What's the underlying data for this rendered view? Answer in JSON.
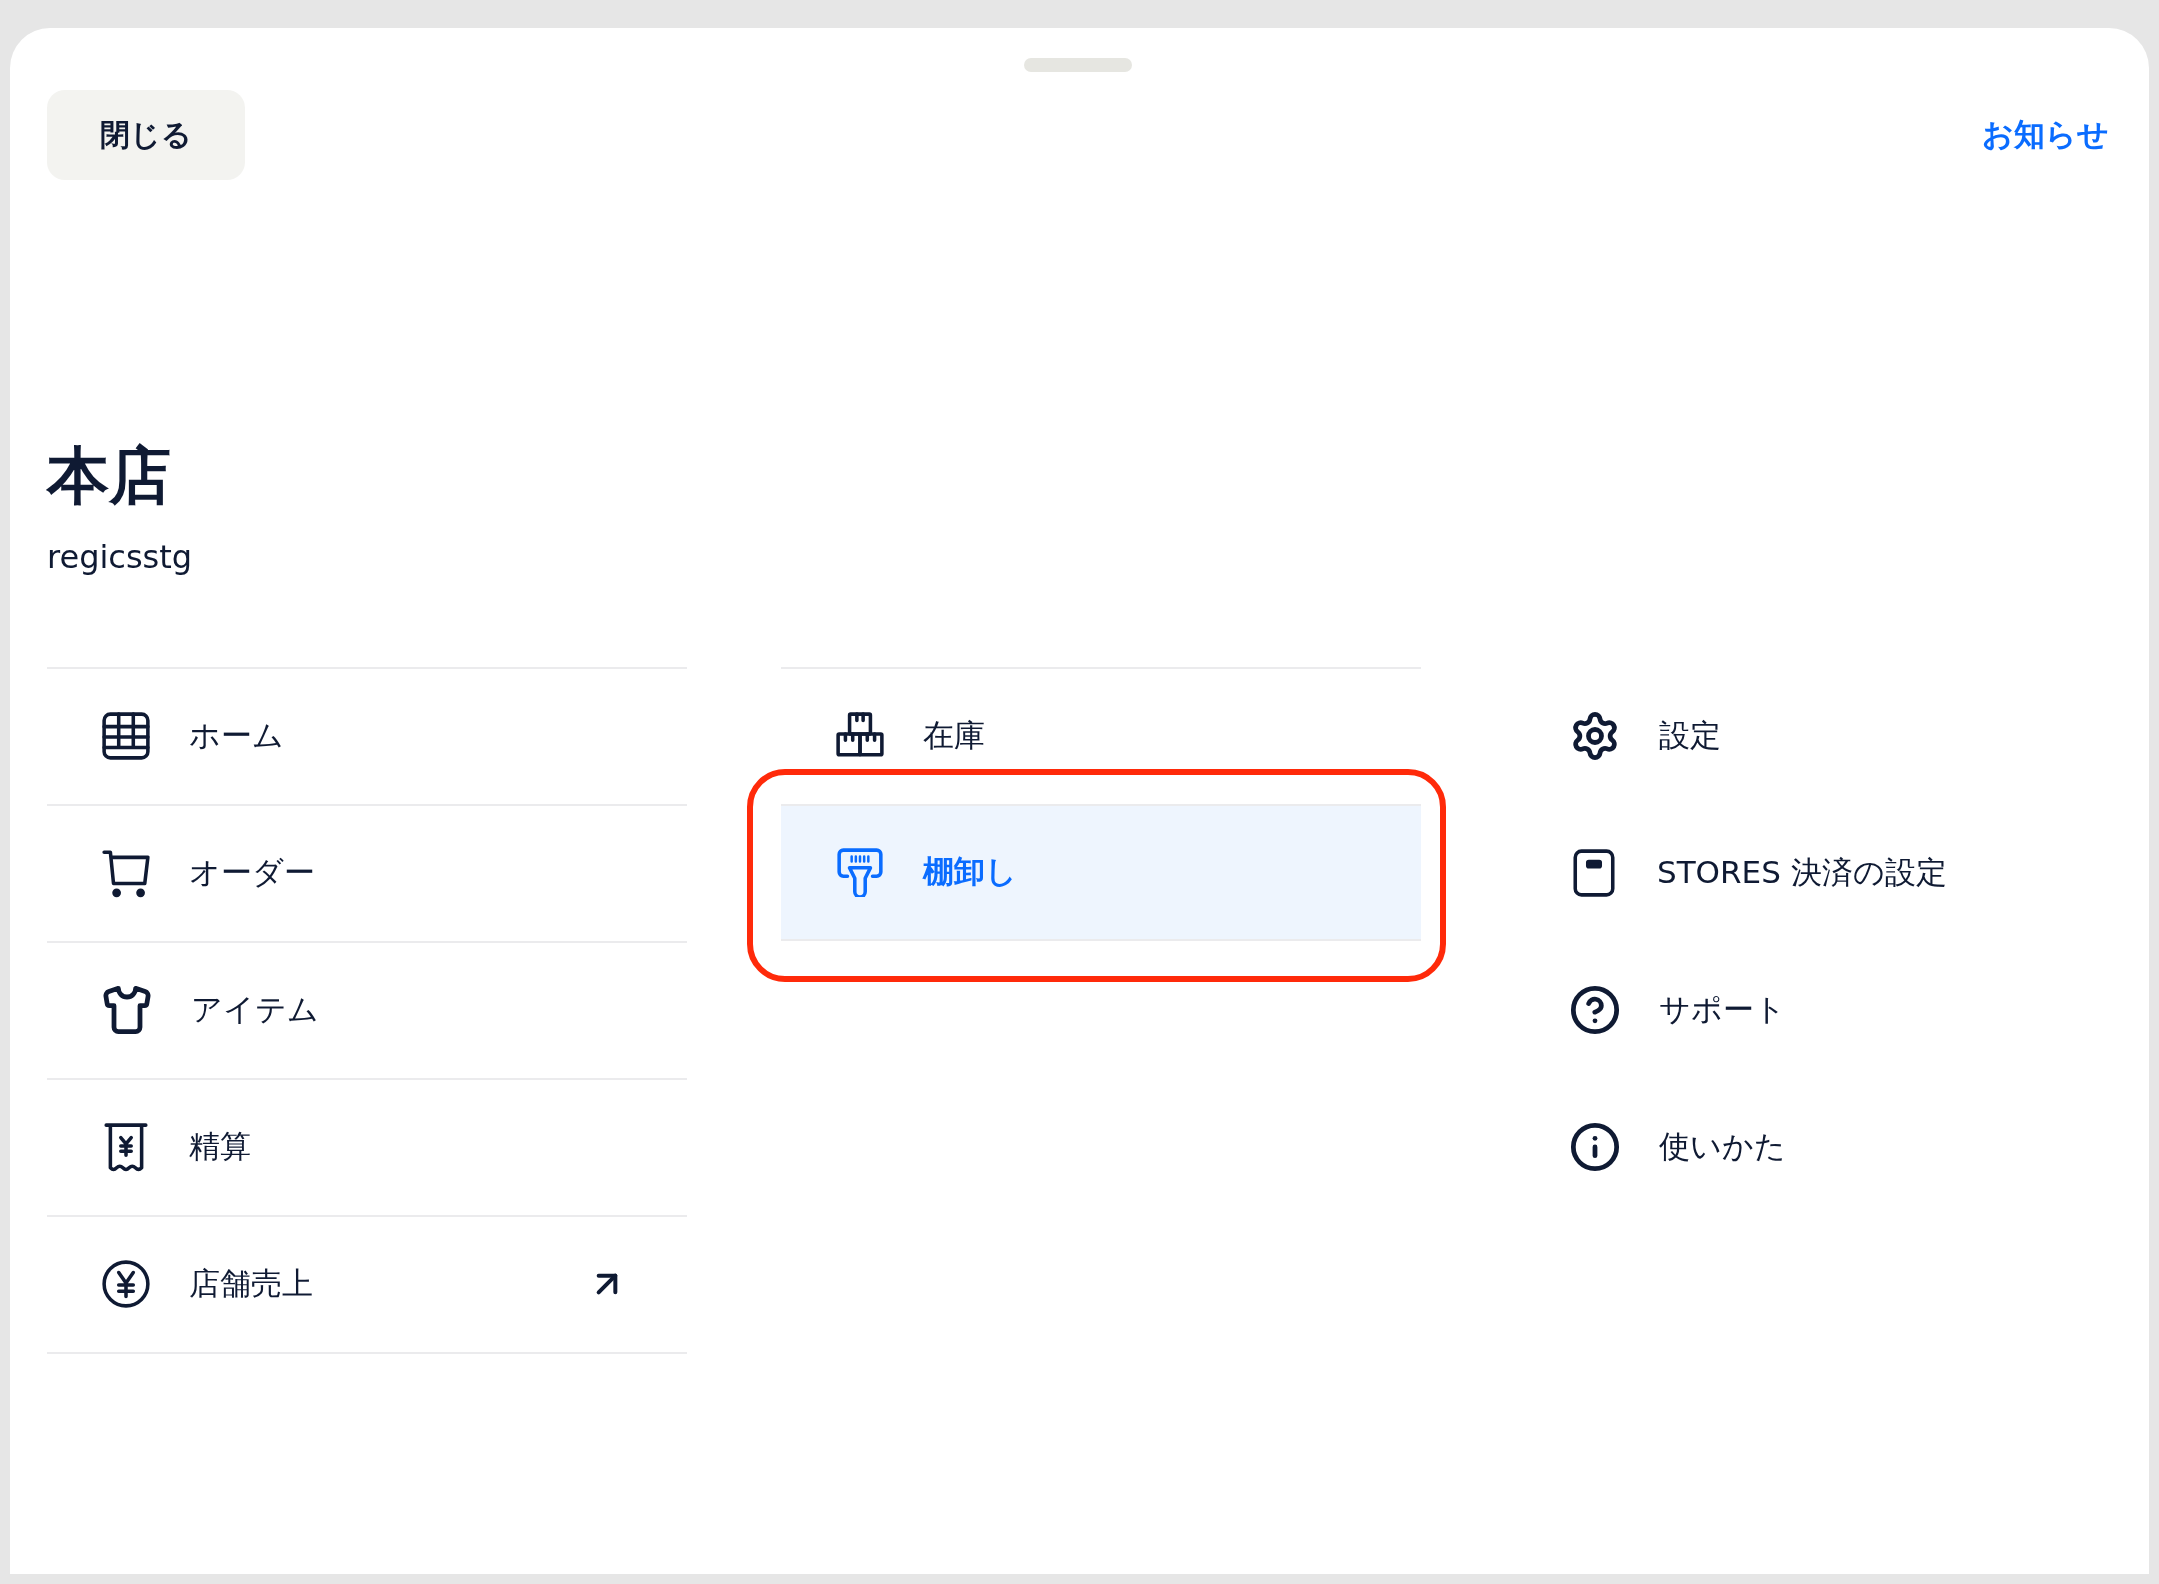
{
  "header": {
    "close_button": "閉じる",
    "notice_link": "お知らせ"
  },
  "store": {
    "name": "本店",
    "account": "regicsstg"
  },
  "columns": [
    {
      "kind": "divided",
      "items": [
        {
          "label": "ホーム",
          "selected": false
        },
        {
          "label": "オーダー",
          "selected": false
        },
        {
          "label": "アイテム",
          "selected": false
        },
        {
          "label": "精算",
          "selected": false
        },
        {
          "label": "店舗売上",
          "selected": false,
          "external": true
        }
      ]
    },
    {
      "kind": "ruled",
      "items": [
        {
          "label": "在庫",
          "selected": false
        },
        {
          "label": "棚卸し",
          "selected": true,
          "highlighted": true
        }
      ]
    },
    {
      "kind": "plain",
      "items": [
        {
          "label": "設定",
          "selected": false
        },
        {
          "label": "STORES 決済の設定",
          "selected": false
        },
        {
          "label": "サポート",
          "selected": false
        },
        {
          "label": "使いかた",
          "selected": false
        }
      ]
    }
  ]
}
